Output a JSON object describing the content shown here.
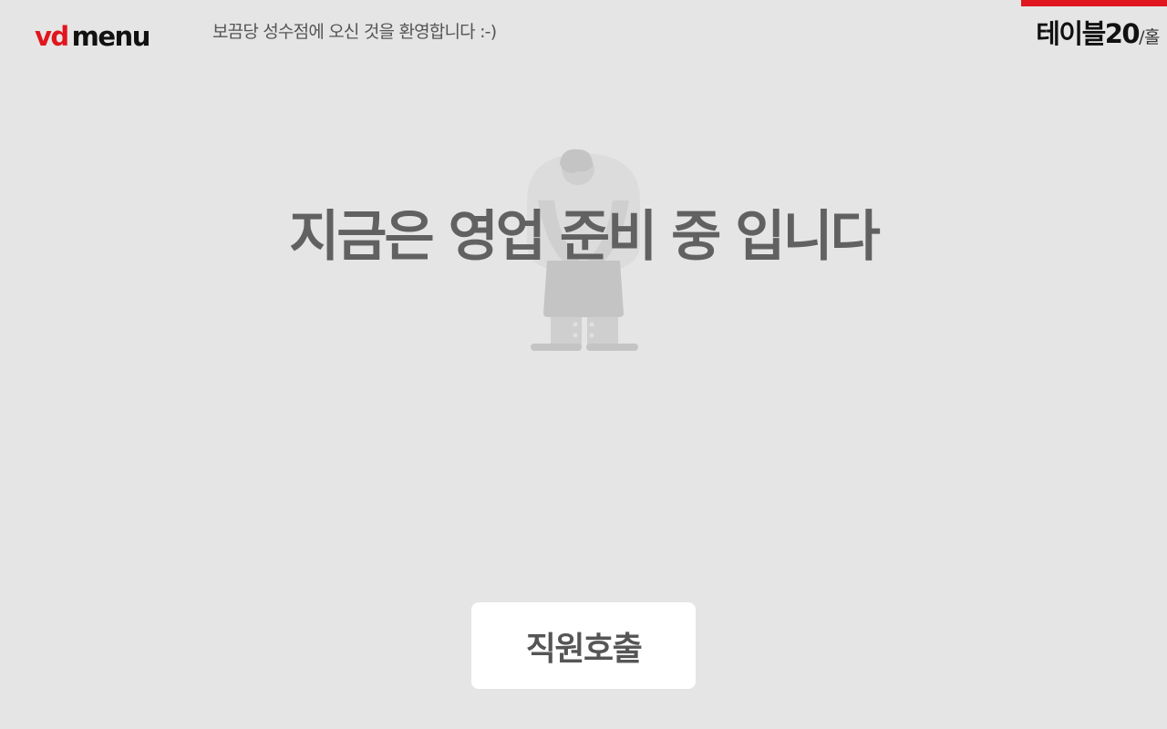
{
  "header": {
    "logo_vd": "vd",
    "logo_menu": "menu",
    "welcome": "보끔당 성수점에 오신 것을 환영합니다 :-)",
    "table_name": "테이블20",
    "table_zone": "/홀"
  },
  "main": {
    "message": "지금은 영업 준비 중 입니다",
    "illustration_icon": "bowing-staff-illustration"
  },
  "actions": {
    "call_staff_label": "직원호출"
  },
  "colors": {
    "accent": "#e0161e",
    "background": "#e5e5e5",
    "message_text": "#616161",
    "button_bg": "#ffffff"
  }
}
